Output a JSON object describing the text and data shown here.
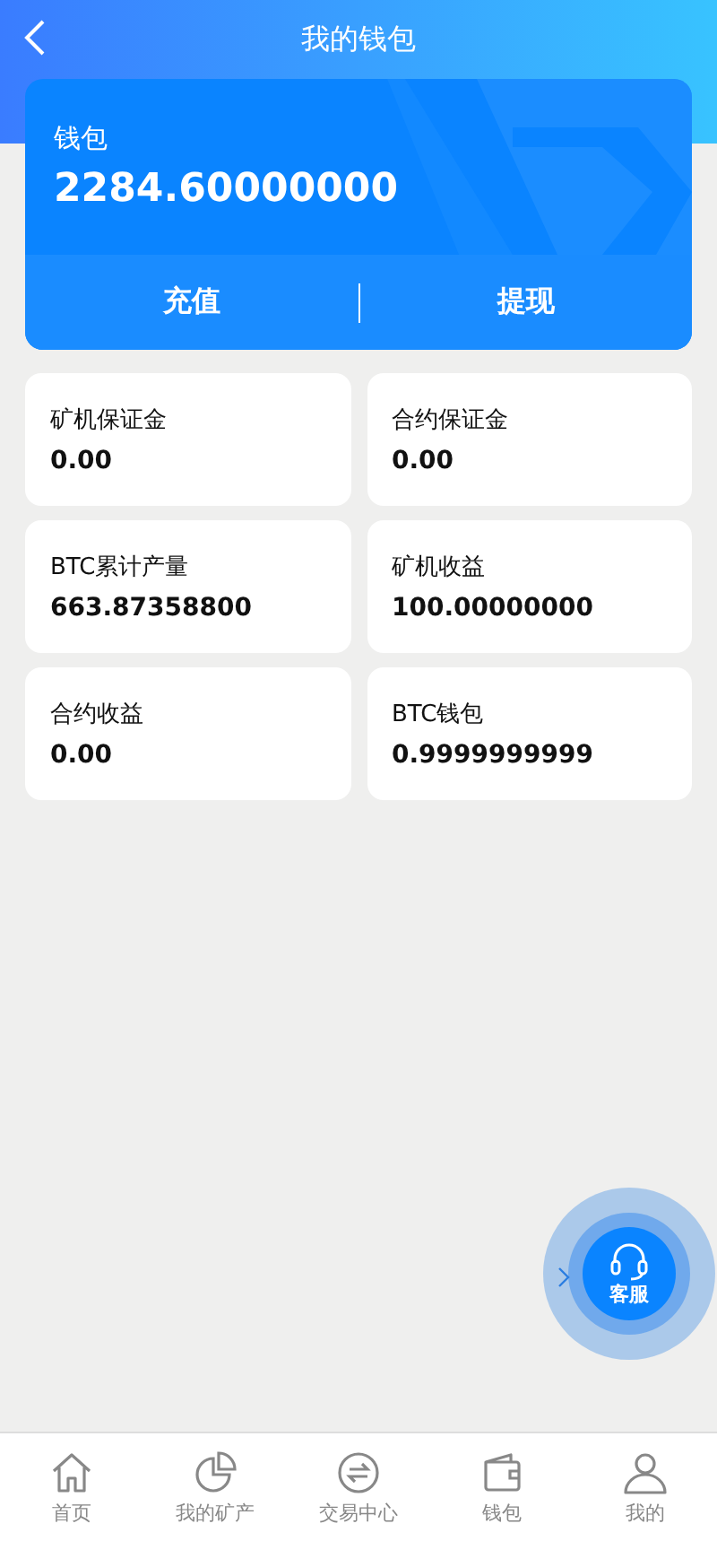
{
  "header": {
    "title": "我的钱包"
  },
  "wallet": {
    "label": "钱包",
    "amount": "2284.60000000",
    "actions": [
      "充值",
      "提现"
    ]
  },
  "stats": [
    {
      "label": "矿机保证金",
      "value": "0.00"
    },
    {
      "label": "合约保证金",
      "value": "0.00"
    },
    {
      "label": "BTC累计产量",
      "value": "663.87358800"
    },
    {
      "label": "矿机收益",
      "value": "100.00000000"
    },
    {
      "label": "合约收益",
      "value": "0.00"
    },
    {
      "label": "BTC钱包",
      "value": "0.9999999999"
    }
  ],
  "service": {
    "label": "客服"
  },
  "tabs": [
    {
      "kind": "home",
      "label": "首页",
      "selected": false
    },
    {
      "kind": "pie",
      "label": "我的矿产",
      "selected": false
    },
    {
      "kind": "exchange",
      "label": "交易中心",
      "selected": false
    },
    {
      "kind": "wallet",
      "label": "钱包",
      "selected": false
    },
    {
      "kind": "user",
      "label": "我的",
      "selected": false
    }
  ]
}
